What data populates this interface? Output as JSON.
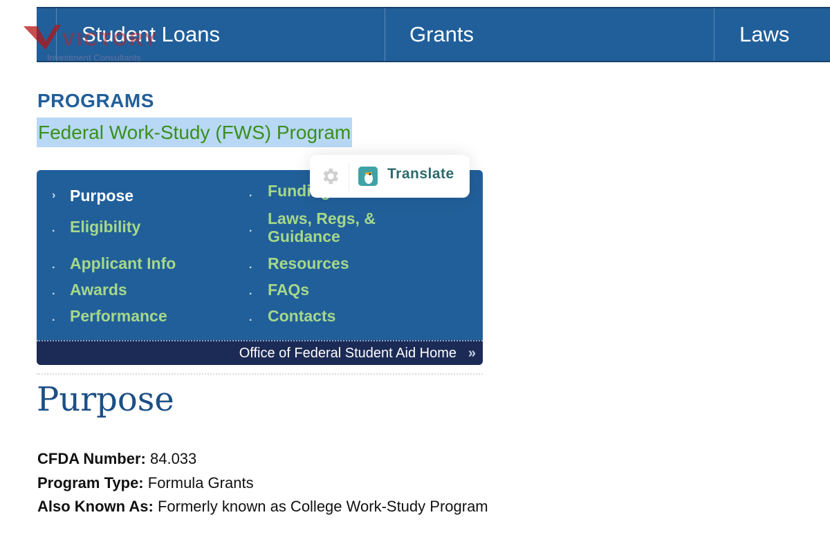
{
  "top_nav": {
    "items": [
      {
        "label": "Student Loans"
      },
      {
        "label": "Grants"
      },
      {
        "label": "Laws"
      }
    ]
  },
  "watermark": {
    "word": "VICTORY",
    "subtitle": "Investment Consultants"
  },
  "header": {
    "eyebrow": "PROGRAMS",
    "title": "Federal Work-Study (FWS) Program"
  },
  "program_menu": {
    "left": [
      "Purpose",
      "Eligibility",
      "Applicant Info",
      "Awards",
      "Performance"
    ],
    "right": [
      "Funding",
      "Laws, Regs, &",
      "Guidance",
      "Resources",
      "FAQs",
      "Contacts"
    ],
    "active": "Purpose",
    "footer_link": "Office of Federal Student Aid Home"
  },
  "translate_popup": {
    "label": "Translate",
    "icons": [
      "gear-icon",
      "translate-logo-icon"
    ]
  },
  "content": {
    "heading": "Purpose",
    "fields": [
      {
        "label": "CFDA Number:",
        "value": "84.033"
      },
      {
        "label": "Program Type:",
        "value": "Formula Grants"
      },
      {
        "label": "Also Known As:",
        "value": "Formerly known as College Work-Study Program"
      }
    ]
  },
  "colors": {
    "nav_blue": "#215f9a",
    "menu_link_green": "#a6d88a",
    "title_green": "#3a8f1a",
    "highlight": "#b8d8f6",
    "footer_navy": "#1c2b55",
    "heading_blue": "#1c4f86"
  }
}
